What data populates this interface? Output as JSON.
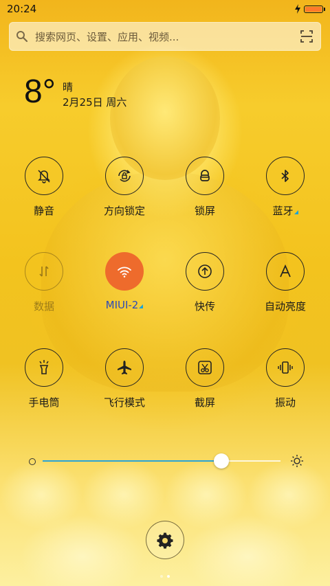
{
  "status_bar": {
    "time": "20:24",
    "battery_level": 1.0,
    "icons": [
      "charging-icon",
      "battery-icon"
    ]
  },
  "search": {
    "placeholder": "搜索网页、设置、应用、视频...",
    "icons": [
      "search-icon",
      "scan-icon"
    ]
  },
  "weather": {
    "temperature": "8°",
    "condition": "晴",
    "date": "2月25日 周六"
  },
  "toggles": [
    {
      "label": "静音",
      "icon": "mute-icon",
      "state": "off"
    },
    {
      "label": "方向锁定",
      "icon": "rotation-lock-icon",
      "state": "off"
    },
    {
      "label": "锁屏",
      "icon": "lock-icon",
      "state": "off"
    },
    {
      "label": "蓝牙",
      "icon": "bluetooth-icon",
      "state": "off",
      "has_more": true
    },
    {
      "label": "数据",
      "icon": "mobile-data-icon",
      "state": "disabled"
    },
    {
      "label": "MIUI-2",
      "icon": "wifi-icon",
      "state": "on",
      "has_more": true
    },
    {
      "label": "快传",
      "icon": "quick-transfer-icon",
      "state": "off"
    },
    {
      "label": "自动亮度",
      "icon": "auto-brightness-icon",
      "state": "off"
    },
    {
      "label": "手电筒",
      "icon": "flashlight-icon",
      "state": "off"
    },
    {
      "label": "飞行模式",
      "icon": "airplane-icon",
      "state": "off"
    },
    {
      "label": "截屏",
      "icon": "screenshot-icon",
      "state": "off"
    },
    {
      "label": "振动",
      "icon": "vibrate-icon",
      "state": "off"
    }
  ],
  "brightness": {
    "level": 0.75,
    "icons": [
      "brightness-low-icon",
      "brightness-high-icon"
    ]
  },
  "settings": {
    "icon": "gear-icon"
  },
  "pager": {
    "pages": 2,
    "current": 2
  },
  "colors": {
    "wifi_active": "#ee6b2c",
    "active_label": "#2c49b8",
    "slider_fill": "#2aa3d6",
    "battery_fill": "#ff7a2b"
  }
}
